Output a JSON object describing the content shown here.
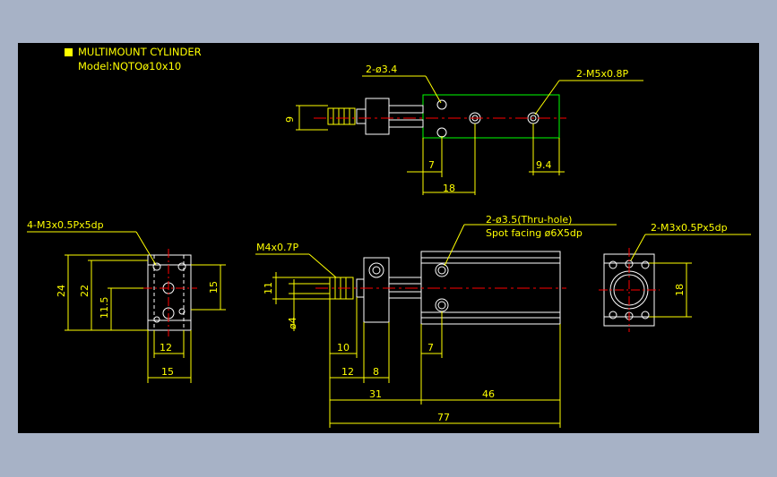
{
  "colors": {
    "window_bg": "#a7b2c6",
    "drawing_bg": "#000000",
    "part_outline": "#ffffff",
    "dimension": "#ffff00",
    "centerline": "#ff0000",
    "hidden_line": "#ffffff",
    "green_outline": "#00ff00",
    "title_marker": "#ffff00"
  },
  "title": {
    "line1": "MULTIMOUNT CYLINDER",
    "line2": "Model:NQTOø10x10"
  },
  "top_view": {
    "hole_callout": "2-ø3.4",
    "port_callout": "2-M5x0.8P",
    "dim_height": "9",
    "dim_7": "7",
    "dim_18": "18",
    "dim_9_4": "9.4"
  },
  "left_view": {
    "callout": "4-M3x0.5Px5dp",
    "dim_24": "24",
    "dim_22": "22",
    "dim_11_5": "11.5",
    "dim_15_v": "15",
    "dim_12": "12",
    "dim_15_h": "15"
  },
  "front_view": {
    "thread_callout": "M4x0.7P",
    "hole_callout_1": "2-ø3.5(Thru-hole)",
    "hole_callout_2": "Spot facing ø6X5dp",
    "dim_11": "11",
    "dim_d4": "ø4",
    "dim_10": "10",
    "dim_12": "12",
    "dim_8": "8",
    "dim_7": "7",
    "dim_31": "31",
    "dim_46": "46",
    "dim_77": "77"
  },
  "right_view": {
    "callout": "2-M3x0.5Px5dp",
    "dim_18": "18"
  }
}
